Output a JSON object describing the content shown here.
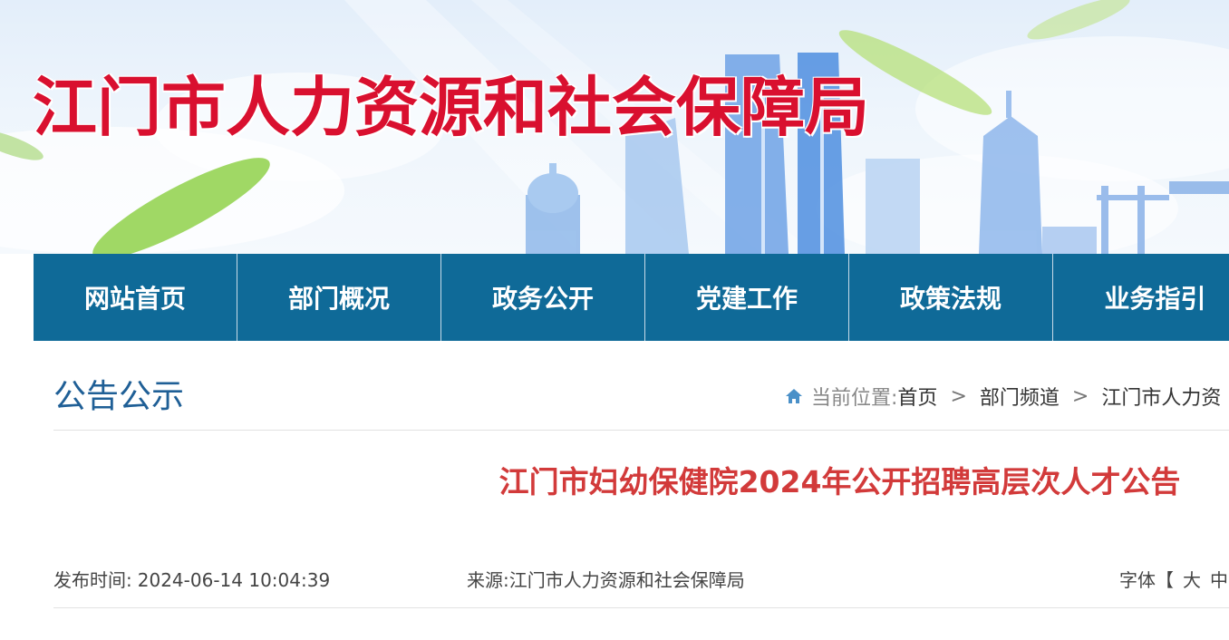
{
  "site": {
    "title": "江门市人力资源和社会保障局"
  },
  "nav": {
    "items": [
      {
        "label": "网站首页"
      },
      {
        "label": "部门概况"
      },
      {
        "label": "政务公开"
      },
      {
        "label": "党建工作"
      },
      {
        "label": "政策法规"
      },
      {
        "label": "业务指引"
      }
    ]
  },
  "section": {
    "title": "公告公示"
  },
  "breadcrumb": {
    "prefix": "当前位置:",
    "items": [
      "首页",
      "部门频道",
      "江门市人力资"
    ],
    "separator": ">"
  },
  "article": {
    "title": "江门市妇幼保健院2024年公开招聘高层次人才公告",
    "publish_label": "发布时间:",
    "publish_time": "2024-06-14 10:04:39",
    "source_label": "来源:",
    "source": "江门市人力资源和社会保障局",
    "font_label": "字体【",
    "font_large": "大",
    "font_medium": "中"
  },
  "colors": {
    "brand_red": "#d9102f",
    "nav_blue": "#0f6a98",
    "section_blue": "#1f5f96",
    "article_red": "#d23a3a"
  },
  "icons": {
    "breadcrumb": "home-icon"
  }
}
